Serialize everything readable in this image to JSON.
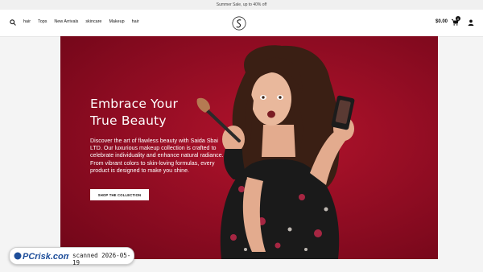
{
  "announcement": "Summer Sale, up to 40% off",
  "nav": {
    "items": [
      "hair",
      "Tops",
      "New Arrivals",
      "skincare",
      "Makeup",
      "hair"
    ]
  },
  "header": {
    "cart_total": "$0.00",
    "cart_count": "0"
  },
  "hero": {
    "title_line1": "Embrace Your",
    "title_line2": "True Beauty",
    "description": "Discover the art of flawless beauty with Saida Sbai LTD. Our luxurious makeup collection is crafted to celebrate individuality and enhance natural radiance. From vibrant colors to skin-loving formulas, every product is designed to make you shine.",
    "cta_label": "SHOP THE COLLECTION"
  },
  "watermark": {
    "logo_text": "PCrisk.com",
    "stamp": "scanned 2026-05-19"
  },
  "colors": {
    "hero_red": "#9b0f25",
    "dress": "#1a1a1a",
    "skin": "#e9b89c"
  }
}
